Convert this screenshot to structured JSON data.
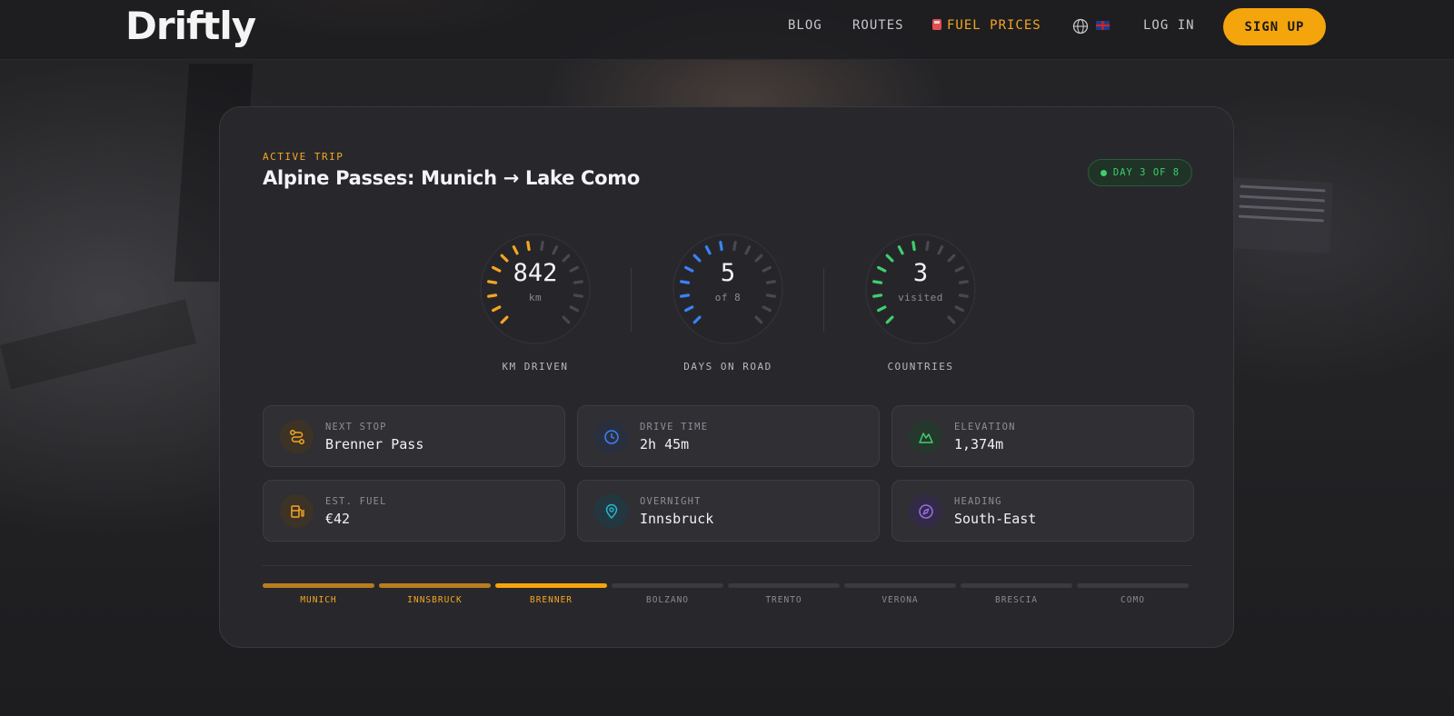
{
  "nav": {
    "logo": "Driftly",
    "links": [
      {
        "label": "BLOG"
      },
      {
        "label": "ROUTES"
      },
      {
        "label": "FUEL PRICES"
      },
      {
        "label": "LOG IN"
      }
    ],
    "language_icon": "globe-icon",
    "flag_icon": "uk-flag-icon",
    "signup_label": "SIGN UP",
    "accent_color": "#f5a50c"
  },
  "trip": {
    "eyebrow": "ACTIVE TRIP",
    "title": "Alpine Passes: Munich → Lake Como",
    "badge": "DAY 3 OF 8",
    "badge_color": "#3ecf6e"
  },
  "gauges": [
    {
      "value": "842",
      "sub": "km",
      "label": "KM DRIVEN",
      "fill": 0.5,
      "color": "#f4a623"
    },
    {
      "value": "5",
      "sub": "of 8",
      "label": "DAYS ON ROAD",
      "fill": 0.5,
      "color": "#3b82f6"
    },
    {
      "value": "3",
      "sub": "visited",
      "label": "COUNTRIES",
      "fill": 0.5,
      "color": "#3ecf6e"
    }
  ],
  "stats": [
    {
      "label": "NEXT STOP",
      "value": "Brenner Pass",
      "icon": "route-icon",
      "color": "#f4a623"
    },
    {
      "label": "DRIVE TIME",
      "value": "2h 45m",
      "icon": "clock-icon",
      "color": "#3b82f6"
    },
    {
      "label": "ELEVATION",
      "value": "1,374m",
      "icon": "mountain-icon",
      "color": "#3ecf6e"
    },
    {
      "label": "EST. FUEL",
      "value": "€42",
      "icon": "fuel-pump-icon",
      "color": "#f4a623"
    },
    {
      "label": "OVERNIGHT",
      "value": "Innsbruck",
      "icon": "map-pin-icon",
      "color": "#22b8cf"
    },
    {
      "label": "HEADING",
      "value": "South-East",
      "icon": "compass-icon",
      "color": "#9b6cf0"
    }
  ],
  "stops": [
    {
      "name": "MUNICH",
      "state": "done"
    },
    {
      "name": "INNSBRUCK",
      "state": "done"
    },
    {
      "name": "BRENNER",
      "state": "current"
    },
    {
      "name": "BOLZANO",
      "state": "upcoming"
    },
    {
      "name": "TRENTO",
      "state": "upcoming"
    },
    {
      "name": "VERONA",
      "state": "upcoming"
    },
    {
      "name": "BRESCIA",
      "state": "upcoming"
    },
    {
      "name": "COMO",
      "state": "upcoming"
    }
  ]
}
